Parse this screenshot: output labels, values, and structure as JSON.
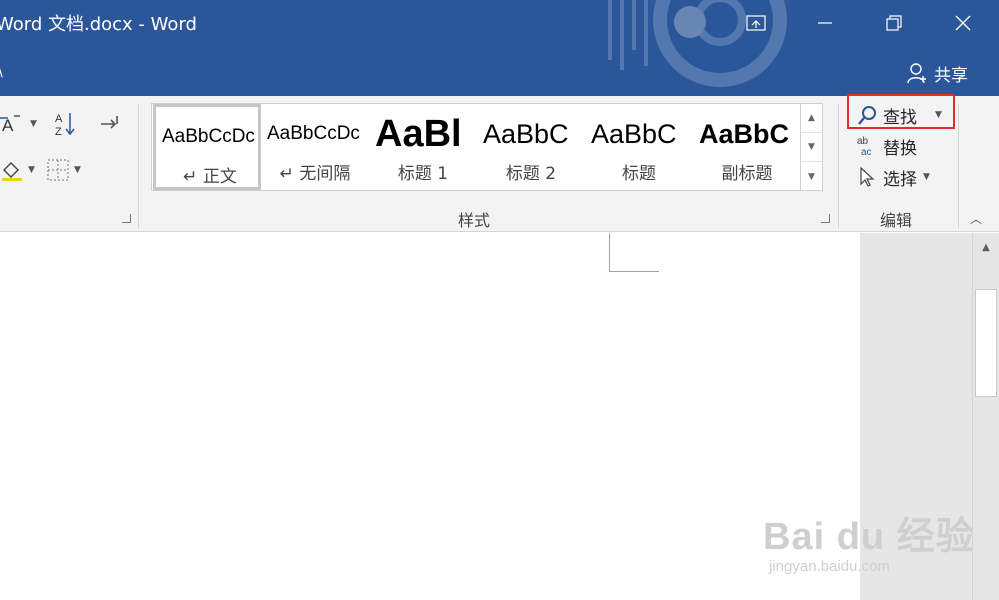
{
  "window": {
    "title": "Word 文档.docx  -  Word",
    "share_label": "共享",
    "left_mark": "\\"
  },
  "ribbon": {
    "styles_group": {
      "label": "样式",
      "items": [
        {
          "preview": "AaBbCcDc",
          "name": "↵ 正文",
          "selected": true
        },
        {
          "preview": "AaBbCcDc",
          "name": "↵ 无间隔",
          "selected": false
        },
        {
          "preview": "AaBl",
          "name": "标题 1",
          "selected": false
        },
        {
          "preview": "AaBbC",
          "name": "标题 2",
          "selected": false
        },
        {
          "preview": "AaBbC",
          "name": "标题",
          "selected": false
        },
        {
          "preview": "AaBbC",
          "name": "副标题",
          "selected": false
        }
      ]
    },
    "editing_group": {
      "label": "编辑",
      "find_label": "查找",
      "replace_label": "替换",
      "select_label": "选择",
      "highlight_color": "#e32b2b"
    }
  },
  "watermark": {
    "main": "Bai du 经验",
    "sub": "jingyan.baidu.com"
  },
  "colors": {
    "title_bar": "#2b579a",
    "ribbon_bg": "#f3f3f3",
    "margin_gray": "#e6e6e6"
  }
}
